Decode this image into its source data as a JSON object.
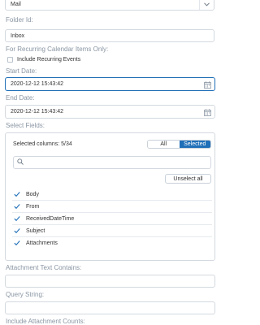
{
  "source": {
    "value": "Mail"
  },
  "folder": {
    "label": "Folder Id:",
    "value": "Inbox"
  },
  "recurring": {
    "label": "For Recurring Calendar Items Only:",
    "checkbox_label": "Include Recurring Events"
  },
  "start_date": {
    "label": "Start Date:",
    "value": "2020-12-12 15:43:42"
  },
  "end_date": {
    "label": "End Date:",
    "value": "2020-12-12 15:43:42"
  },
  "select_fields": {
    "label": "Select Fields:",
    "selected_count": "Selected columns: 5/34",
    "toggle": {
      "all": "All",
      "selected": "Selected"
    },
    "search_placeholder": "",
    "unselect_all": "Unselect all",
    "items": [
      {
        "label": "Body"
      },
      {
        "label": "From"
      },
      {
        "label": "ReceivedDateTime"
      },
      {
        "label": "Subject"
      },
      {
        "label": "Attachments"
      }
    ]
  },
  "attachment_text": {
    "label": "Attachment Text Contains:",
    "value": ""
  },
  "query_string": {
    "label": "Query String:",
    "value": ""
  },
  "attachment_counts": {
    "label": "Include Attachment Counts:"
  },
  "colors": {
    "accent": "#1f6fb8",
    "label": "#8a96a3",
    "border": "#d3d9df"
  }
}
